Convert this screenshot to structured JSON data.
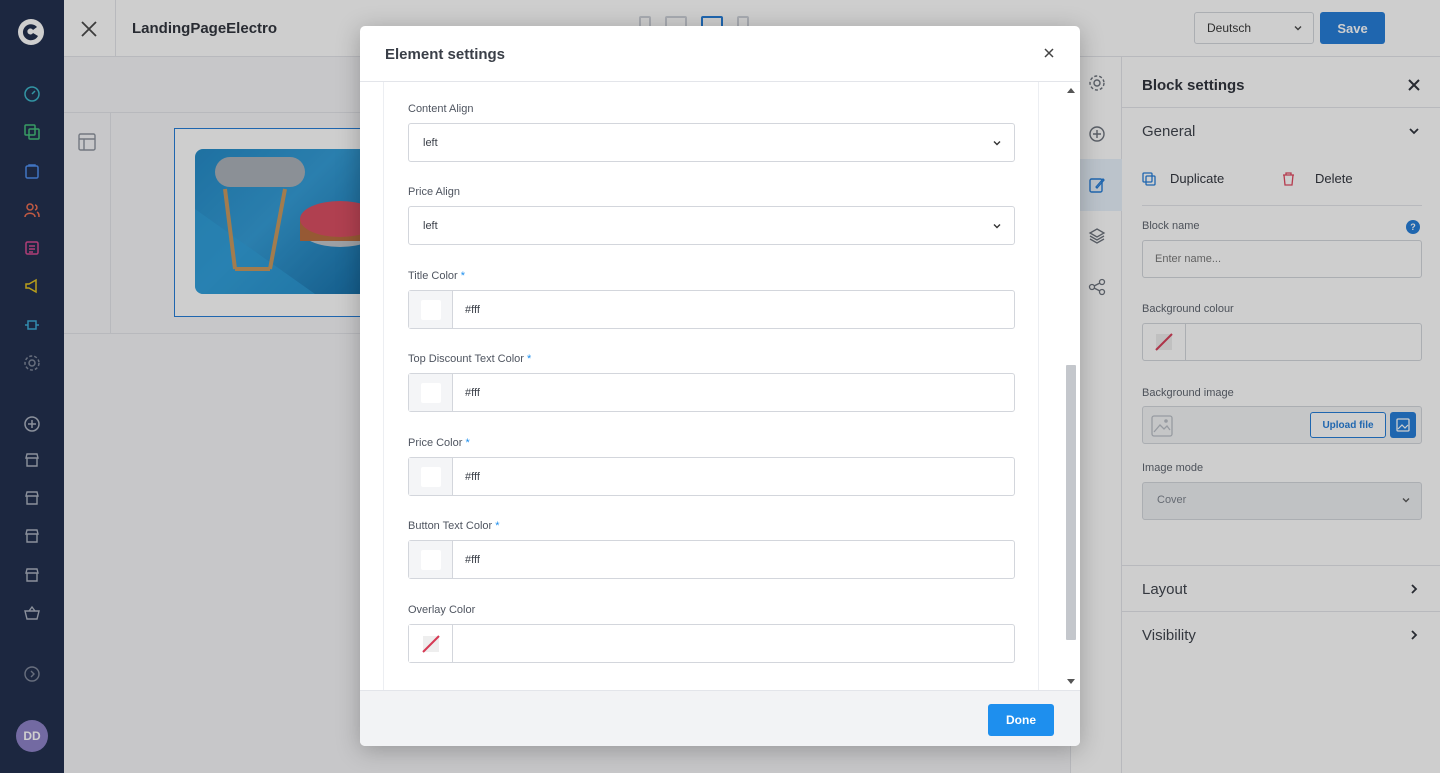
{
  "app": {
    "page_title": "LandingPageElectro",
    "language": "Deutsch",
    "save_label": "Save",
    "avatar_initials": "DD"
  },
  "block_settings": {
    "title": "Block settings",
    "general_label": "General",
    "duplicate_label": "Duplicate",
    "delete_label": "Delete",
    "block_name_label": "Block name",
    "block_name_placeholder": "Enter name...",
    "background_colour_label": "Background colour",
    "background_image_label": "Background image",
    "upload_label": "Upload file",
    "image_mode_label": "Image mode",
    "image_mode_value": "Cover",
    "layout_label": "Layout",
    "visibility_label": "Visibility",
    "info_glyph": "?"
  },
  "modal": {
    "title": "Element settings",
    "done_label": "Done",
    "required_marker": "*",
    "fields": {
      "content_align": {
        "label": "Content Align",
        "value": "left"
      },
      "price_align": {
        "label": "Price Align",
        "value": "left"
      },
      "title_color": {
        "label": "Title Color",
        "value": "#fff"
      },
      "top_discount_text_color": {
        "label": "Top Discount Text Color",
        "value": "#fff"
      },
      "price_color": {
        "label": "Price Color",
        "value": "#fff"
      },
      "button_text_color": {
        "label": "Button Text Color",
        "value": "#fff"
      },
      "overlay_color": {
        "label": "Overlay Color",
        "value": ""
      }
    }
  },
  "colors": {
    "accent": "#1f7ad8",
    "nav_bg": "#1c2a4a",
    "done_button": "#1e8fee",
    "delete_icon": "#e0435b"
  }
}
